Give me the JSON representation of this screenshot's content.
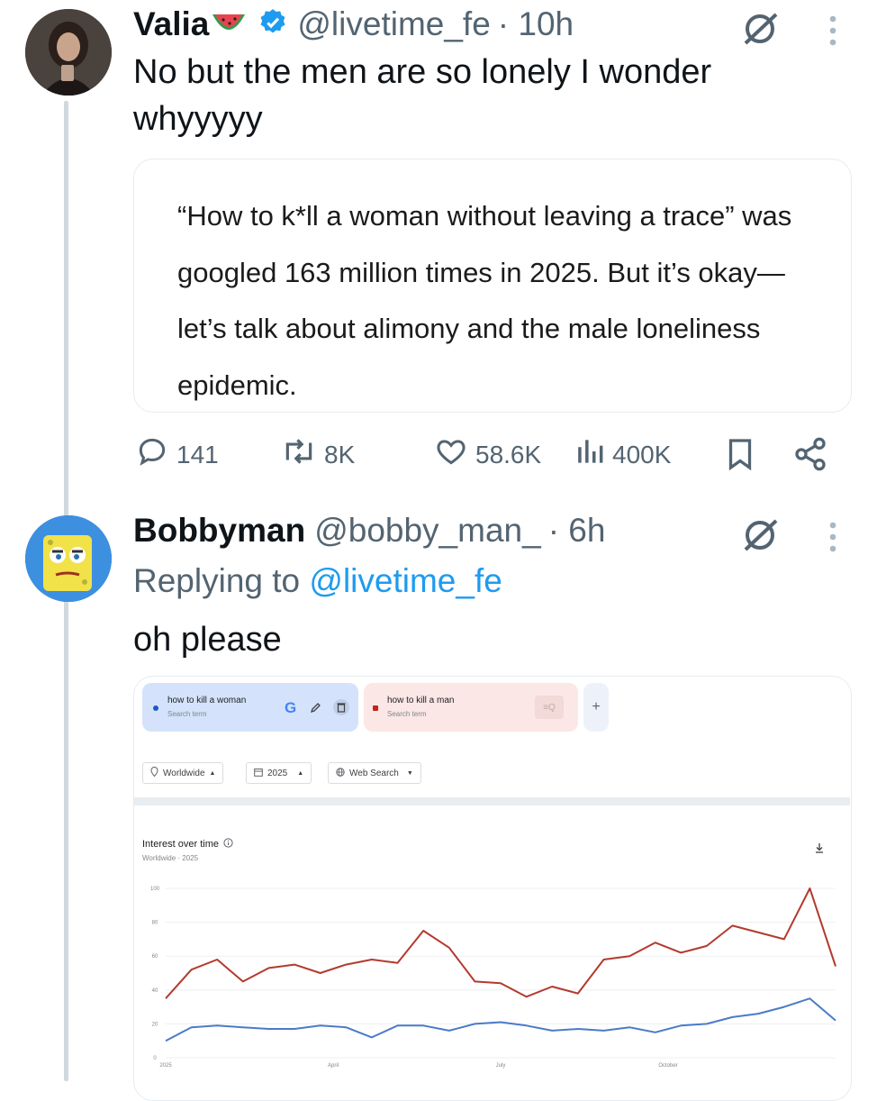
{
  "tweet1": {
    "display_name": "Valia",
    "handle": "@livetime_fe",
    "time": "· 10h",
    "text": "No but the men are so lonely I wonder whyyyyy",
    "quote_text": "“How to k*ll a woman without leaving a trace” was googled 163 million times in 2025. But it’s okay—let’s talk about alimony and the male loneliness epidemic.",
    "stats": {
      "replies": "141",
      "retweets": "8K",
      "likes": "58.6K",
      "views": "400K"
    }
  },
  "tweet2": {
    "display_name": "Bobbyman",
    "handle": "@bobby_man_",
    "time": "· 6h",
    "replying_prefix": "Replying to",
    "replying_handle": "@livetime_fe",
    "text": "oh please"
  },
  "trends": {
    "term1": "how to kill a woman",
    "term1_sub": "Search term",
    "term2": "how to kill a man",
    "term2_sub": "Search term",
    "add": "+",
    "filter_region": "Worldwide",
    "filter_year": "2025",
    "filter_type": "Web Search",
    "section_title": "Interest over time",
    "section_sub": "Worldwide · 2025"
  },
  "colors": {
    "blue_link": "#1d9bf0",
    "series_woman": "#4a7bc8",
    "series_man": "#b33a2e",
    "verified": "#1d9bf0"
  },
  "chart_data": {
    "type": "line",
    "ylim": [
      0,
      100
    ],
    "y_ticks": [
      "0",
      "20",
      "40",
      "60",
      "80",
      "100"
    ],
    "x_tick_labels": [
      "2025",
      "April",
      "July",
      "October"
    ],
    "x": [
      0,
      2,
      4,
      6,
      8,
      10,
      12,
      14,
      16,
      18,
      20,
      22,
      24,
      26,
      28,
      30,
      32,
      34,
      36,
      38,
      40,
      42,
      44,
      46,
      48,
      50,
      52
    ],
    "series": [
      {
        "name": "how to kill a woman",
        "values": [
          10,
          18,
          19,
          18,
          17,
          17,
          19,
          18,
          12,
          19,
          19,
          16,
          20,
          21,
          19,
          16,
          17,
          16,
          18,
          15,
          19,
          20,
          24,
          26,
          30,
          35,
          22
        ]
      },
      {
        "name": "how to kill a man",
        "values": [
          35,
          52,
          58,
          45,
          53,
          55,
          50,
          55,
          58,
          56,
          75,
          65,
          45,
          44,
          36,
          42,
          38,
          58,
          60,
          68,
          62,
          66,
          78,
          74,
          70,
          100,
          54
        ]
      }
    ]
  }
}
